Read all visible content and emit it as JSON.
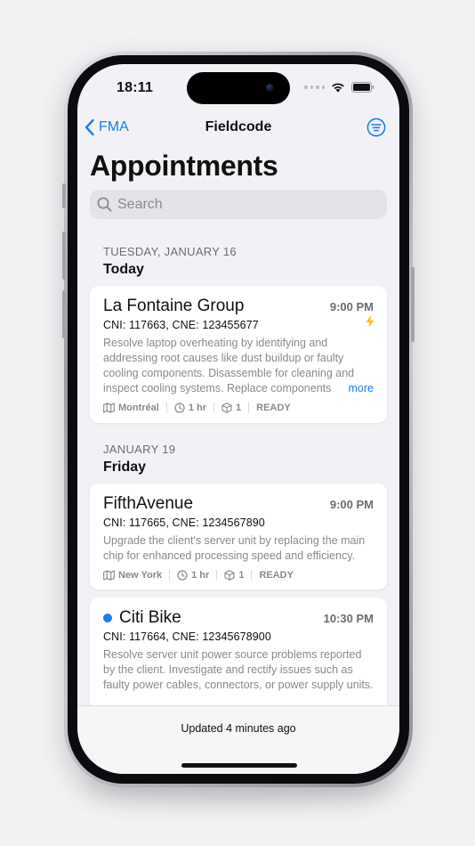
{
  "status_bar": {
    "time": "18:11"
  },
  "nav": {
    "back_label": "FMA",
    "title": "Fieldcode"
  },
  "page": {
    "title": "Appointments"
  },
  "search": {
    "placeholder": "Search"
  },
  "sections": [
    {
      "date": "TUESDAY, JANUARY 16",
      "day": "Today",
      "appointments": [
        {
          "name": "La Fontaine Group",
          "time": "9:00 PM",
          "ids": "CNI: 117663, CNE: 123455677",
          "description": "Resolve laptop overheating by identifying and addressing root causes like dust buildup or faulty cooling components. Disassemble for cleaning and inspect cooling systems. Replace components",
          "more_label": "more",
          "location": "Montréal",
          "duration": "1 hr",
          "parts": "1",
          "status": "READY",
          "urgent_icon": "lightning-bolt-icon"
        }
      ]
    },
    {
      "date": "JANUARY 19",
      "day": "Friday",
      "appointments": [
        {
          "name": "FifthAvenue",
          "time": "9:00 PM",
          "ids": "CNI: 117665, CNE: 1234567890",
          "description": "Upgrade the client's server unit by replacing the main chip for enhanced processing speed and efficiency.",
          "location": "New York",
          "duration": "1 hr",
          "parts": "1",
          "status": "READY"
        },
        {
          "name": "Citi Bike",
          "time": "10:30 PM",
          "ids": "CNI: 117664, CNE: 12345678900",
          "description": "Resolve server unit power source problems reported by the client. Investigate and rectify issues such as faulty power cables, connectors, or power supply units.",
          "unread_indicator": "blue-dot"
        }
      ]
    }
  ],
  "footer": {
    "updated_text": "Updated 4 minutes ago"
  },
  "colors": {
    "accent": "#1a7cf0",
    "urgent": "#f5c518",
    "background": "#f2f2f6"
  }
}
